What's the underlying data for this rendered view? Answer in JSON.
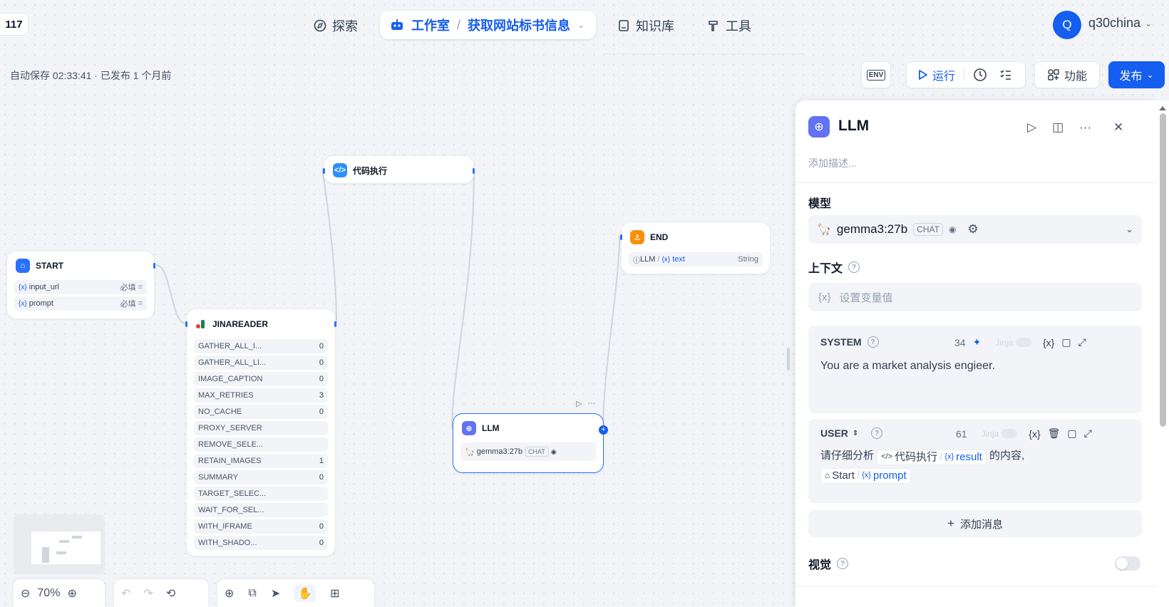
{
  "top_nav": {
    "badge": "117",
    "explore": "探索",
    "studio": "工作室",
    "breadcrumb_sep": "/",
    "app_name": "获取网站标书信息",
    "knowledge": "知识库",
    "tools": "工具",
    "avatar_letter": "Q",
    "username": "q30china"
  },
  "status": {
    "autosave": "自动保存 02:33:41 · 已发布 1 个月前"
  },
  "toolbar": {
    "env": "ENV",
    "run": "运行",
    "features": "功能",
    "publish": "发布"
  },
  "nodes": {
    "code": {
      "title": "代码执行"
    },
    "start": {
      "title": "START",
      "vars": [
        {
          "name": "input_url",
          "required": "必填"
        },
        {
          "name": "prompt",
          "required": "必填"
        }
      ]
    },
    "jina": {
      "title": "JINAREADER",
      "params": [
        {
          "name": "GATHER_ALL_I...",
          "value": "0"
        },
        {
          "name": "GATHER_ALL_LI...",
          "value": "0"
        },
        {
          "name": "IMAGE_CAPTION",
          "value": "0"
        },
        {
          "name": "MAX_RETRIES",
          "value": "3"
        },
        {
          "name": "NO_CACHE",
          "value": "0"
        },
        {
          "name": "PROXY_SERVER",
          "value": ""
        },
        {
          "name": "REMOVE_SELE...",
          "value": ""
        },
        {
          "name": "RETAIN_IMAGES",
          "value": "1"
        },
        {
          "name": "SUMMARY",
          "value": "0"
        },
        {
          "name": "TARGET_SELEC...",
          "value": ""
        },
        {
          "name": "WAIT_FOR_SEL...",
          "value": ""
        },
        {
          "name": "WITH_IFRAME",
          "value": "0"
        },
        {
          "name": "WITH_SHADO...",
          "value": "0"
        }
      ]
    },
    "end": {
      "title": "END",
      "output_src": "LLM",
      "output_var": "text",
      "output_type": "String"
    },
    "llm": {
      "title": "LLM",
      "model": "gemma3:27b",
      "mode": "CHAT"
    }
  },
  "zoom": "70%",
  "panel": {
    "title": "LLM",
    "desc_placeholder": "添加描述...",
    "model_label": "模型",
    "model": "gemma3:27b",
    "model_mode": "CHAT",
    "context_label": "上下文",
    "context_placeholder": "设置变量值",
    "system": {
      "label": "SYSTEM",
      "count": "34",
      "jinja": "Jinja",
      "text": "You are a market analysis engieer."
    },
    "user": {
      "label": "USER",
      "count": "61",
      "jinja": "Jinja",
      "text_before": "请仔细分析",
      "ref1_node": "代码执行",
      "ref1_var": "result",
      "text_after": "的内容,",
      "ref2_node": "Start",
      "ref2_var": "prompt"
    },
    "add_message": "添加消息",
    "vision_label": "视觉"
  },
  "colors": {
    "accent": "#155eef",
    "start_icon": "#2970ff",
    "code_icon": "#2e90fa",
    "end_icon": "#f79009",
    "llm_icon": "#6172f3"
  }
}
